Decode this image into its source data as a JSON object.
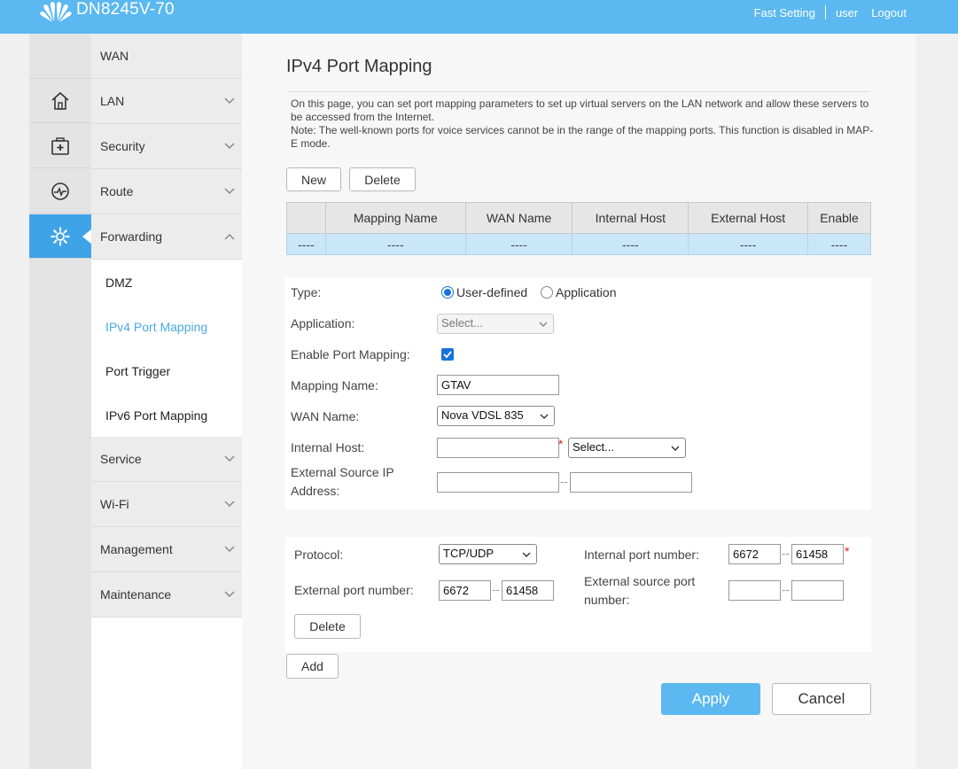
{
  "header": {
    "brand": "DN8245V-70",
    "nav": {
      "fast_setting": "Fast Setting",
      "user": "user",
      "logout": "Logout"
    },
    "colors": {
      "bar": "#5bb8f0"
    }
  },
  "iconstrip": {
    "icons": [
      "home-icon",
      "first-aid-icon",
      "pulse-icon",
      "gear-icon"
    ],
    "active": "gear-icon"
  },
  "menu": {
    "wan": "WAN",
    "lan": "LAN",
    "security": "Security",
    "route": "Route",
    "forwarding": "Forwarding",
    "sub": {
      "dmz": "DMZ",
      "ipv4": "IPv4 Port Mapping",
      "port_trigger": "Port Trigger",
      "ipv6": "IPv6 Port Mapping"
    },
    "service": "Service",
    "wifi": "Wi-Fi",
    "management": "Management",
    "maintenance": "Maintenance"
  },
  "main": {
    "title": "IPv4 Port Mapping",
    "desc1": "On this page, you can set port mapping parameters to set up virtual servers on the LAN network and allow these servers to be accessed from the Internet.",
    "desc2": "Note: The well-known ports for voice services cannot be in the range of the mapping ports. This function is disabled in MAP-E mode.",
    "new_label": "New",
    "delete_label": "Delete",
    "table": {
      "headers": [
        "",
        "Mapping Name",
        "WAN Name",
        "Internal Host",
        "External Host",
        "Enable"
      ],
      "row": [
        "----",
        "----",
        "----",
        "----",
        "----",
        "----"
      ]
    },
    "form": {
      "type_label": "Type:",
      "type_user_defined": "User-defined",
      "type_application": "Application",
      "application_label": "Application:",
      "application_value": "Select...",
      "enable_label": "Enable Port Mapping:",
      "enable_checked": true,
      "mapping_name_label": "Mapping Name:",
      "mapping_name_value": "GTAV",
      "wan_name_label": "WAN Name:",
      "wan_name_value": "Nova VDSL 835",
      "internal_host_label": "Internal Host:",
      "internal_host_value": "",
      "internal_host_select": "Select...",
      "external_source_ip_label1": "External Source IP",
      "external_source_ip_label2": "Address:",
      "ext_ip_from": "",
      "ext_ip_to": "",
      "required_mark": "*",
      "range_sep": "--"
    },
    "ports": {
      "protocol_label": "Protocol:",
      "protocol_value": "TCP/UDP",
      "internal_port_label": "Internal port number:",
      "internal_port_from": "6672",
      "internal_port_to": "61458",
      "external_port_label": "External port number:",
      "external_port_from": "6672",
      "external_port_to": "61458",
      "external_source_port_label1": "External source port",
      "external_source_port_label2": "number:",
      "ext_src_port_from": "",
      "ext_src_port_to": "",
      "delete_label": "Delete"
    },
    "add_label": "Add",
    "apply_label": "Apply",
    "cancel_label": "Cancel"
  }
}
